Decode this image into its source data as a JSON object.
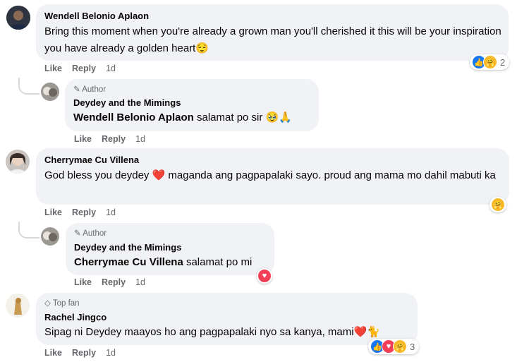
{
  "comments": [
    {
      "author": "Wendell Belonio Aplaon",
      "text": "Bring this moment when you're already a grown man you'll cherished it this will be your inspiration you have already a golden heart😌",
      "actions": {
        "like": "Like",
        "reply": "Reply",
        "time": "1d"
      },
      "reactions": {
        "icons": [
          "like-icon",
          "care-icon"
        ],
        "count": "2"
      },
      "reply": {
        "badge": "Author",
        "author": "Deydey and the Mimings",
        "mention": "Wendell Belonio Aplaon",
        "text": " salamat po sir 🥹🙏",
        "actions": {
          "like": "Like",
          "reply": "Reply",
          "time": "1d"
        }
      }
    },
    {
      "author": "Cherrymae Cu Villena",
      "text": "God bless you deydey ❤️ maganda ang pagpapalaki sayo. proud ang mama mo dahil mabuti ka",
      "actions": {
        "like": "Like",
        "reply": "Reply",
        "time": "1d"
      },
      "reactions": {
        "icons": [
          "care-icon"
        ]
      },
      "reply": {
        "badge": "Author",
        "author": "Deydey and the Mimings",
        "mention": "Cherrymae Cu Villena",
        "text": " salamat po mi",
        "actions": {
          "like": "Like",
          "reply": "Reply",
          "time": "1d"
        },
        "reactions": {
          "icons": [
            "love-icon"
          ]
        }
      }
    },
    {
      "badge": "Top fan",
      "author": "Rachel Jingco",
      "text": "Sipag ni Deydey maayos ho ang pagpapalaki nyo sa kanya, mami❤️🐈",
      "actions": {
        "like": "Like",
        "reply": "Reply",
        "time": "1d"
      },
      "reactions": {
        "icons": [
          "like-icon",
          "love-icon",
          "care-icon"
        ],
        "count": "3"
      }
    }
  ],
  "colors": {
    "bubble": "#f0f2f5",
    "meta": "#65676b",
    "like": "#1877f2",
    "love": "#f33e58",
    "care": "#f7b928"
  }
}
